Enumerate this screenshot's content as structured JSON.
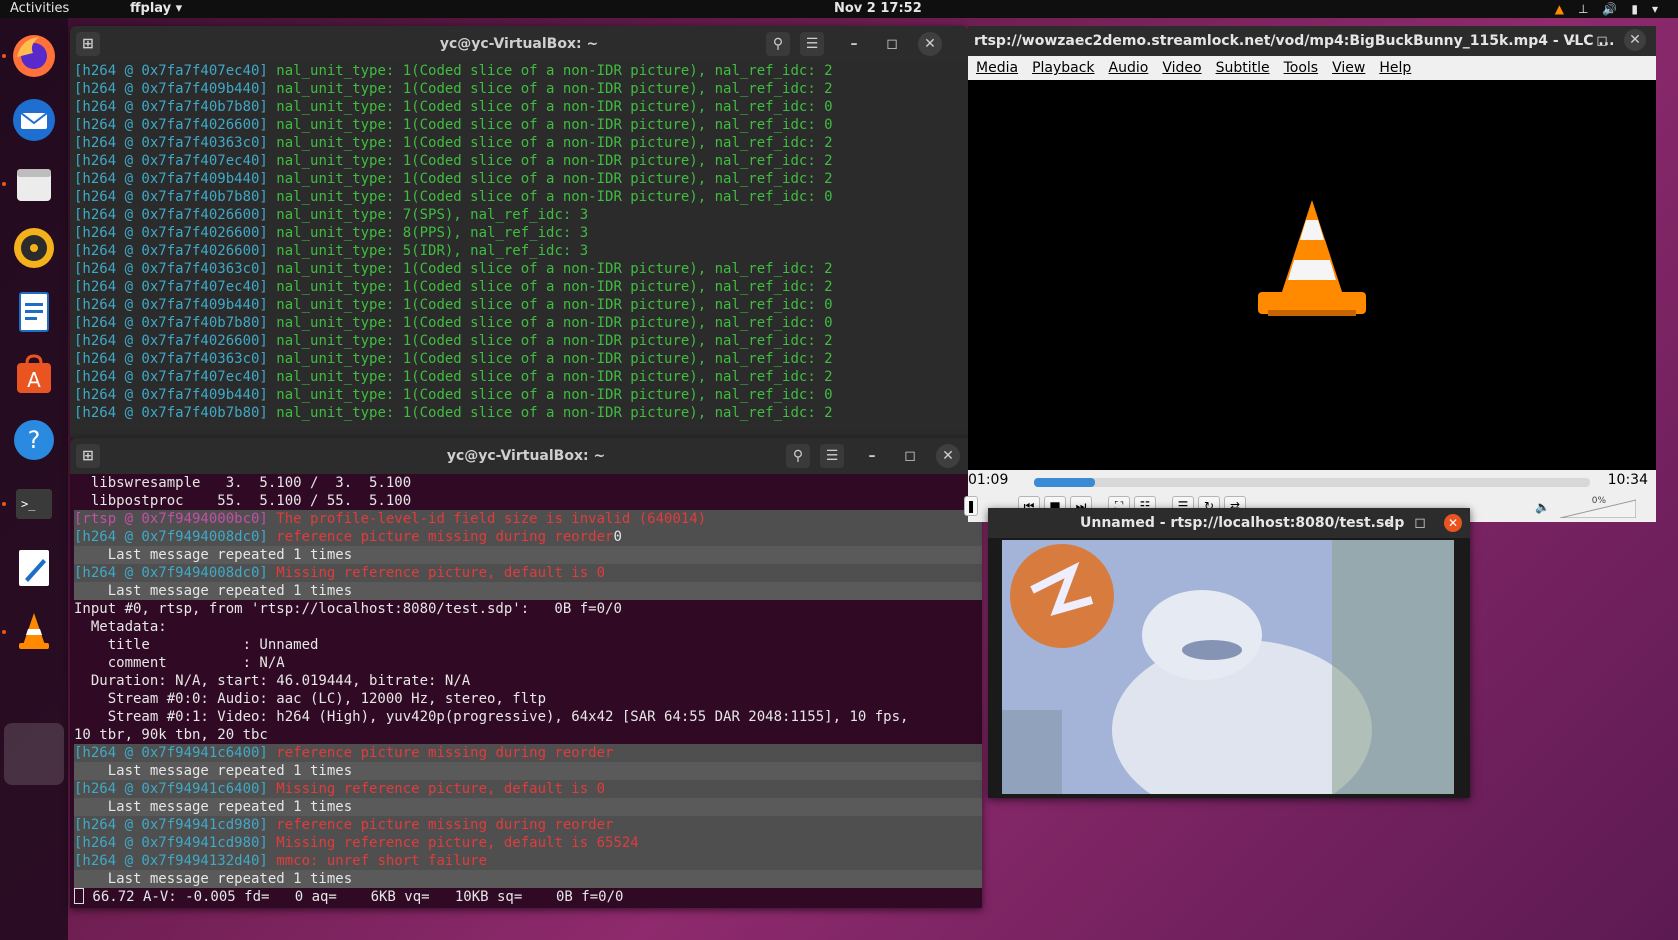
{
  "topbar": {
    "activities": "Activities",
    "app_menu": "ffplay ▾",
    "clock": "Nov 2  17:52"
  },
  "colors": {
    "ubuntu_orange": "#e95420",
    "terminal_bg": "#300a24",
    "vlc_seek": "#3b8ad6"
  },
  "dock": {
    "items": [
      "firefox-icon",
      "thunderbird-icon",
      "files-icon",
      "rhythmbox-icon",
      "writer-icon",
      "software-icon",
      "help-icon",
      "terminal-icon",
      "text-editor-icon",
      "vlc-icon"
    ],
    "grid": "show-applications-icon"
  },
  "terminal1": {
    "title": "yc@yc-VirtualBox: ~",
    "lines": [
      [
        "[h264 @ 0x7fa7f407ec40]",
        " nal_unit_type: 1(Coded slice of a non-IDR picture), nal_ref_idc: 2"
      ],
      [
        "[h264 @ 0x7fa7f409b440]",
        " nal_unit_type: 1(Coded slice of a non-IDR picture), nal_ref_idc: 2"
      ],
      [
        "[h264 @ 0x7fa7f40b7b80]",
        " nal_unit_type: 1(Coded slice of a non-IDR picture), nal_ref_idc: 0"
      ],
      [
        "[h264 @ 0x7fa7f4026600]",
        " nal_unit_type: 1(Coded slice of a non-IDR picture), nal_ref_idc: 0"
      ],
      [
        "[h264 @ 0x7fa7f40363c0]",
        " nal_unit_type: 1(Coded slice of a non-IDR picture), nal_ref_idc: 2"
      ],
      [
        "[h264 @ 0x7fa7f407ec40]",
        " nal_unit_type: 1(Coded slice of a non-IDR picture), nal_ref_idc: 2"
      ],
      [
        "[h264 @ 0x7fa7f409b440]",
        " nal_unit_type: 1(Coded slice of a non-IDR picture), nal_ref_idc: 2"
      ],
      [
        "[h264 @ 0x7fa7f40b7b80]",
        " nal_unit_type: 1(Coded slice of a non-IDR picture), nal_ref_idc: 0"
      ],
      [
        "[h264 @ 0x7fa7f4026600]",
        " nal_unit_type: 7(SPS), nal_ref_idc: 3"
      ],
      [
        "[h264 @ 0x7fa7f4026600]",
        " nal_unit_type: 8(PPS), nal_ref_idc: 3"
      ],
      [
        "[h264 @ 0x7fa7f4026600]",
        " nal_unit_type: 5(IDR), nal_ref_idc: 3"
      ],
      [
        "[h264 @ 0x7fa7f40363c0]",
        " nal_unit_type: 1(Coded slice of a non-IDR picture), nal_ref_idc: 2"
      ],
      [
        "[h264 @ 0x7fa7f407ec40]",
        " nal_unit_type: 1(Coded slice of a non-IDR picture), nal_ref_idc: 2"
      ],
      [
        "[h264 @ 0x7fa7f409b440]",
        " nal_unit_type: 1(Coded slice of a non-IDR picture), nal_ref_idc: 0"
      ],
      [
        "[h264 @ 0x7fa7f40b7b80]",
        " nal_unit_type: 1(Coded slice of a non-IDR picture), nal_ref_idc: 0"
      ],
      [
        "[h264 @ 0x7fa7f4026600]",
        " nal_unit_type: 1(Coded slice of a non-IDR picture), nal_ref_idc: 2"
      ],
      [
        "[h264 @ 0x7fa7f40363c0]",
        " nal_unit_type: 1(Coded slice of a non-IDR picture), nal_ref_idc: 2"
      ],
      [
        "[h264 @ 0x7fa7f407ec40]",
        " nal_unit_type: 1(Coded slice of a non-IDR picture), nal_ref_idc: 2"
      ],
      [
        "[h264 @ 0x7fa7f409b440]",
        " nal_unit_type: 1(Coded slice of a non-IDR picture), nal_ref_idc: 0"
      ],
      [
        "[h264 @ 0x7fa7f40b7b80]",
        " nal_unit_type: 1(Coded slice of a non-IDR picture), nal_ref_idc: 2"
      ]
    ]
  },
  "terminal2": {
    "title": "yc@yc-VirtualBox: ~",
    "lines": [
      {
        "t": "plain",
        "a": "  libswresample   3.  5.100 /  3.  5.100"
      },
      {
        "t": "plain",
        "a": "  libpostproc    55.  5.100 / 55.  5.100"
      },
      {
        "t": "err",
        "tag": "mag",
        "a": "[rtsp @ 0x7f9494000bc0]",
        "b": " The profile-level-id field size is invalid (640014)"
      },
      {
        "t": "err",
        "tag": "cyan",
        "a": "[h264 @ 0x7f9494008dc0]",
        "b": " reference picture missing during reorder",
        "c": "0"
      },
      {
        "t": "plain",
        "a": "    Last message repeated 1 times",
        "hl": true
      },
      {
        "t": "err",
        "tag": "cyan",
        "a": "[h264 @ 0x7f9494008dc0]",
        "b": " Missing reference picture, default is 0"
      },
      {
        "t": "plain",
        "a": "    Last message repeated 1 times",
        "hl": true
      },
      {
        "t": "plain",
        "a": "Input #0, rtsp, from 'rtsp://localhost:8080/test.sdp':   0B f=0/0"
      },
      {
        "t": "plain",
        "a": "  Metadata:"
      },
      {
        "t": "plain",
        "a": "    title           : Unnamed"
      },
      {
        "t": "plain",
        "a": "    comment         : N/A"
      },
      {
        "t": "plain",
        "a": "  Duration: N/A, start: 46.019444, bitrate: N/A"
      },
      {
        "t": "plain",
        "a": "    Stream #0:0: Audio: aac (LC), 12000 Hz, stereo, fltp"
      },
      {
        "t": "plain",
        "a": "    Stream #0:1: Video: h264 (High), yuv420p(progressive), 64x42 [SAR 64:55 DAR 2048:1155], 10 fps,"
      },
      {
        "t": "plain",
        "a": "10 tbr, 90k tbn, 20 tbc"
      },
      {
        "t": "err",
        "tag": "cyan",
        "a": "[h264 @ 0x7f94941c6400]",
        "b": " reference picture missing during reorder"
      },
      {
        "t": "plain",
        "a": "    Last message repeated 1 times",
        "hl": true
      },
      {
        "t": "err",
        "tag": "cyan",
        "a": "[h264 @ 0x7f94941c6400]",
        "b": " Missing reference picture, default is 0"
      },
      {
        "t": "plain",
        "a": "    Last message repeated 1 times",
        "hl": true
      },
      {
        "t": "err",
        "tag": "cyan",
        "a": "[h264 @ 0x7f94941cd980]",
        "b": " reference picture missing during reorder"
      },
      {
        "t": "err",
        "tag": "cyan",
        "a": "[h264 @ 0x7f94941cd980]",
        "b": " Missing reference picture, default is 65524"
      },
      {
        "t": "err",
        "tag": "cyan",
        "a": "[h264 @ 0x7f9494132d40]",
        "b": " mmco: unref short failure"
      },
      {
        "t": "plain",
        "a": "    Last message repeated 1 times",
        "hl": true
      },
      {
        "t": "status",
        "a": " 66.72 A-V: -0.005 fd=   0 aq=    6KB vq=   10KB sq=    0B f=0/0"
      }
    ]
  },
  "vlc": {
    "title": "rtsp://wowzaec2demo.streamlock.net/vod/mp4:BigBuckBunny_115k.mp4 - VLC ...",
    "menu": [
      "Media",
      "Playback",
      "Audio",
      "Video",
      "Subtitle",
      "Tools",
      "View",
      "Help"
    ],
    "time_elapsed": "01:09",
    "time_total": "10:34",
    "progress_fraction": 0.11,
    "volume_label": "0%"
  },
  "ffplay": {
    "title": "Unnamed - rtsp://localhost:8080/test.sdp"
  }
}
